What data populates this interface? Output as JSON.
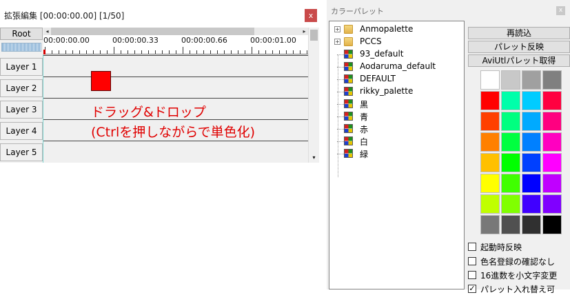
{
  "ext_window": {
    "title": "拡張編集 [00:00:00.00] [1/50]",
    "close_glyph": "x",
    "root_label": "Root",
    "time_labels": [
      "00:00:00.00",
      "00:00:00.33",
      "00:00:00.66",
      "00:00:01.00"
    ],
    "layers": [
      "Layer 1",
      "Layer 2",
      "Layer 3",
      "Layer 4",
      "Layer 5"
    ],
    "overlay_line1": "ドラッグ&ドロップ",
    "overlay_line2": "(Ctrlを押しながらで単色化)",
    "scroll_left": "◂",
    "scroll_right": "▸",
    "scroll_down": "▾"
  },
  "palette_window": {
    "title": "カラーパレット",
    "close_glyph": "x",
    "tree": [
      {
        "label": "Anmopalette",
        "icon": "folder-icon",
        "expandable": true
      },
      {
        "label": "PCCS",
        "icon": "folder-icon",
        "expandable": true
      },
      {
        "label": "93_default",
        "icon": "palette-icon",
        "expandable": false
      },
      {
        "label": "Aodaruma_default",
        "icon": "palette-icon",
        "expandable": false
      },
      {
        "label": "DEFAULT",
        "icon": "palette-icon",
        "expandable": false
      },
      {
        "label": "rikky_palette",
        "icon": "palette-icon",
        "expandable": false
      },
      {
        "label": "黒",
        "icon": "palette-icon",
        "expandable": false
      },
      {
        "label": "青",
        "icon": "palette-icon",
        "expandable": false
      },
      {
        "label": "赤",
        "icon": "palette-icon",
        "expandable": false
      },
      {
        "label": "白",
        "icon": "palette-icon",
        "expandable": false
      },
      {
        "label": "緑",
        "icon": "palette-icon",
        "expandable": false
      }
    ],
    "buttons": [
      "再読込",
      "パレット反映",
      "AviUtlパレット取得"
    ],
    "swatches": [
      [
        "#ffffff",
        "#c8c8c8",
        "#a0a0a0",
        "#808080"
      ],
      [
        "#ff0000",
        "#00ffaa",
        "#00ccff",
        "#ff0040"
      ],
      [
        "#ff4000",
        "#00ff80",
        "#00aaff",
        "#ff0080"
      ],
      [
        "#ff8000",
        "#00ff40",
        "#0080ff",
        "#ff00c0"
      ],
      [
        "#ffc000",
        "#00ff00",
        "#0040ff",
        "#ff00ff"
      ],
      [
        "#ffff00",
        "#40ff00",
        "#0000ff",
        "#c000ff"
      ],
      [
        "#c0ff00",
        "#80ff00",
        "#4000ff",
        "#8000ff"
      ],
      [
        "#787878",
        "#505050",
        "#303030",
        "#000000"
      ]
    ],
    "checkboxes": [
      {
        "label": "起動時反映",
        "checked": false
      },
      {
        "label": "色名登録の確認なし",
        "checked": false
      },
      {
        "label": "16進数を小文字変更",
        "checked": false
      },
      {
        "label": "パレット入れ替え可",
        "checked": true
      }
    ]
  }
}
